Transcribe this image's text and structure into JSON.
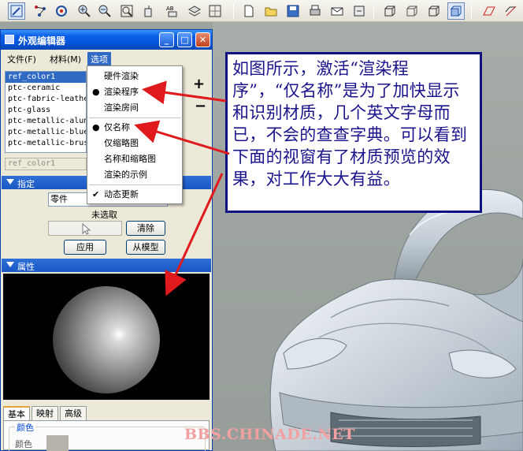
{
  "dialog": {
    "title": "外观编辑器",
    "menus": [
      "文件(F)",
      "材料(M)",
      "选项"
    ],
    "materials": [
      "ref_color1",
      "ptc-ceramic",
      "ptc-fabric-leather",
      "ptc-glass",
      "ptc-metallic-aluminum",
      "ptc-metallic-blue",
      "ptc-metallic-brushed"
    ],
    "selected_material_field": "ref_color1",
    "add_label": "+",
    "remove_label": "−",
    "assign_section": "指定",
    "assign_combo": "零件",
    "no_selection": "未选取",
    "clear_label": "清除",
    "apply_label": "应用",
    "from_model_label": "从模型",
    "properties_section": "属性",
    "tabs": [
      "基本",
      "映射",
      "高级"
    ],
    "color_group": "颜色",
    "color_label": "颜色"
  },
  "options_menu": {
    "items": [
      {
        "label": "硬件渲染",
        "mark": ""
      },
      {
        "label": "渲染程序",
        "mark": "●"
      },
      {
        "label": "渲染房间",
        "mark": ""
      },
      {
        "label": "仅名称",
        "mark": "●"
      },
      {
        "label": "仅缩略图",
        "mark": ""
      },
      {
        "label": "名称和缩略图",
        "mark": ""
      },
      {
        "label": "渲染的示例",
        "mark": ""
      },
      {
        "label": "动态更新",
        "mark": "✔"
      }
    ]
  },
  "annotation": {
    "text": "如图所示，激活“渲染程序”，“仅名称”是为了加快显示和识别材质，几个英文字母而已，不会的查查字典。可以看到下面的视窗有了材质预览的效果，对工作大大有益。",
    "color": "#1a138c",
    "arrow_color": "#e0191c"
  },
  "watermark": "BBS.CHINADE.NET"
}
